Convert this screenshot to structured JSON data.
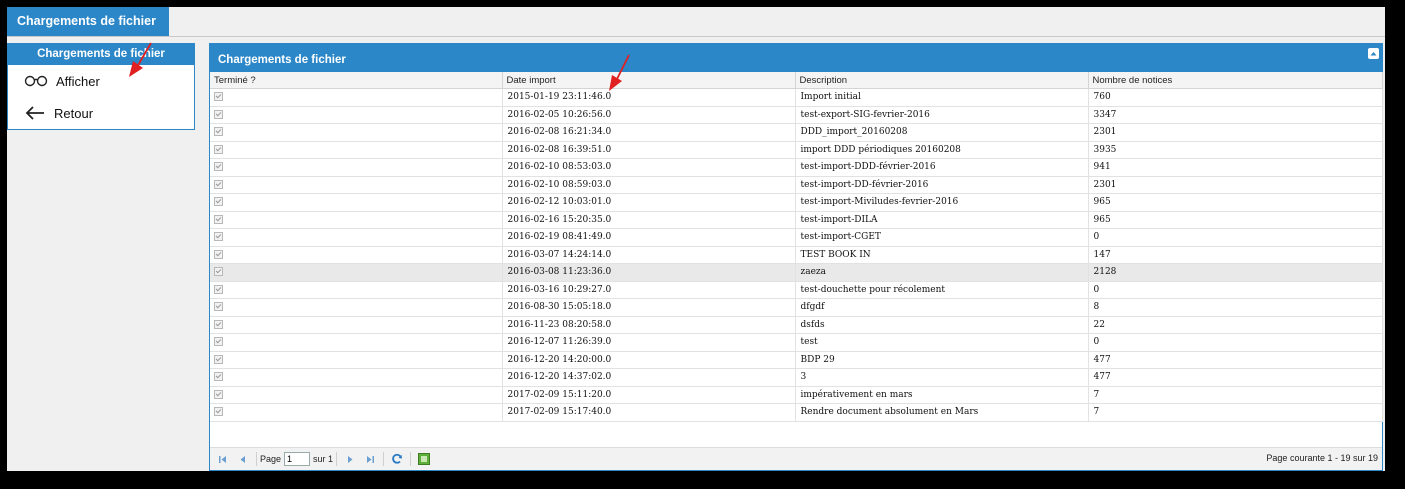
{
  "tab": {
    "title": "Chargements de fichier"
  },
  "left_menu": {
    "header": "Chargements de fichier",
    "items": [
      {
        "label": "Afficher",
        "icon": "glasses-icon"
      },
      {
        "label": "Retour",
        "icon": "arrow-left-icon"
      }
    ]
  },
  "grid": {
    "title": "Chargements de fichier",
    "columns": [
      "Terminé ?",
      "Date import",
      "Description",
      "Nombre de notices"
    ],
    "rows": [
      {
        "date": "2015-01-19 23:11:46.0",
        "description": "Import initial",
        "count": "760"
      },
      {
        "date": "2016-02-05 10:26:56.0",
        "description": "test-export-SIG-fevrier-2016",
        "count": "3347"
      },
      {
        "date": "2016-02-08 16:21:34.0",
        "description": "DDD_import_20160208",
        "count": "2301"
      },
      {
        "date": "2016-02-08 16:39:51.0",
        "description": "import DDD périodiques 20160208",
        "count": "3935"
      },
      {
        "date": "2016-02-10 08:53:03.0",
        "description": "test-import-DDD-février-2016",
        "count": "941"
      },
      {
        "date": "2016-02-10 08:59:03.0",
        "description": "test-import-DD-février-2016",
        "count": "2301"
      },
      {
        "date": "2016-02-12 10:03:01.0",
        "description": "test-import-Miviludes-fevrier-2016",
        "count": "965"
      },
      {
        "date": "2016-02-16 15:20:35.0",
        "description": "test-import-DILA",
        "count": "965"
      },
      {
        "date": "2016-02-19 08:41:49.0",
        "description": "test-import-CGET",
        "count": "0"
      },
      {
        "date": "2016-03-07 14:24:14.0",
        "description": "TEST BOOK IN",
        "count": "147"
      },
      {
        "date": "2016-03-08 11:23:36.0",
        "description": "zaeza",
        "count": "2128"
      },
      {
        "date": "2016-03-16 10:29:27.0",
        "description": "test-douchette pour récolement",
        "count": "0"
      },
      {
        "date": "2016-08-30 15:05:18.0",
        "description": "dfgdf",
        "count": "8"
      },
      {
        "date": "2016-11-23 08:20:58.0",
        "description": "dsfds",
        "count": "22"
      },
      {
        "date": "2016-12-07 11:26:39.0",
        "description": "test",
        "count": "0"
      },
      {
        "date": "2016-12-20 14:20:00.0",
        "description": "BDP 29",
        "count": "477"
      },
      {
        "date": "2016-12-20 14:37:02.0",
        "description": "3",
        "count": "477"
      },
      {
        "date": "2017-02-09 15:11:20.0",
        "description": "impérativement en mars",
        "count": "7"
      },
      {
        "date": "2017-02-09 15:17:40.0",
        "description": "Rendre document absolument en Mars",
        "count": "7"
      }
    ],
    "selected_row": 10
  },
  "pager": {
    "page_label": "Page",
    "page_value": "1",
    "of_label": "sur 1",
    "status": "Page courante 1 - 19 sur 19"
  },
  "colors": {
    "accent": "#2b87c8",
    "annotation_arrow": "#e02020"
  }
}
